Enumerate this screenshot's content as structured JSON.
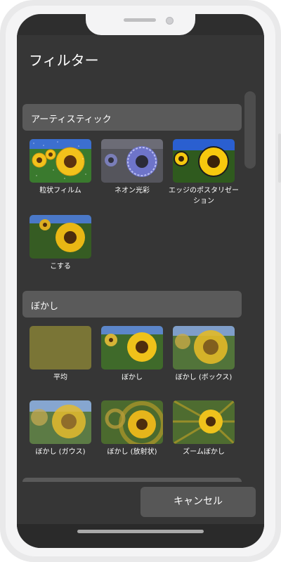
{
  "dialog": {
    "title": "フィルター",
    "cancel_label": "キャンセル"
  },
  "sections": [
    {
      "header": "アーティスティック",
      "items": [
        {
          "label": "粒状フィルム",
          "thumbnail": "sunflower-grain-film"
        },
        {
          "label": "ネオン光彩",
          "thumbnail": "sunflower-neon-glow"
        },
        {
          "label": "エッジのポスタリゼーション",
          "thumbnail": "sunflower-poster-edges"
        },
        {
          "label": "こする",
          "thumbnail": "sunflower-smudge"
        }
      ]
    },
    {
      "header": "ぼかし",
      "items": [
        {
          "label": "平均",
          "thumbnail": "average-olive-swatch"
        },
        {
          "label": "ぼかし",
          "thumbnail": "sunflower-blur"
        },
        {
          "label": "ぼかし (ボックス)",
          "thumbnail": "sunflower-box-blur"
        },
        {
          "label": "ぼかし (ガウス)",
          "thumbnail": "sunflower-gaussian-blur"
        },
        {
          "label": "ぼかし (放射状)",
          "thumbnail": "sunflower-radial-blur"
        },
        {
          "label": "ズームぼかし",
          "thumbnail": "sunflower-zoom-blur"
        }
      ]
    },
    {
      "header": "",
      "items": []
    }
  ],
  "colors": {
    "panel": "#363636",
    "section_header": "#5a5a5a",
    "cancel_button": "#575757",
    "average_swatch": "#7a7536"
  }
}
